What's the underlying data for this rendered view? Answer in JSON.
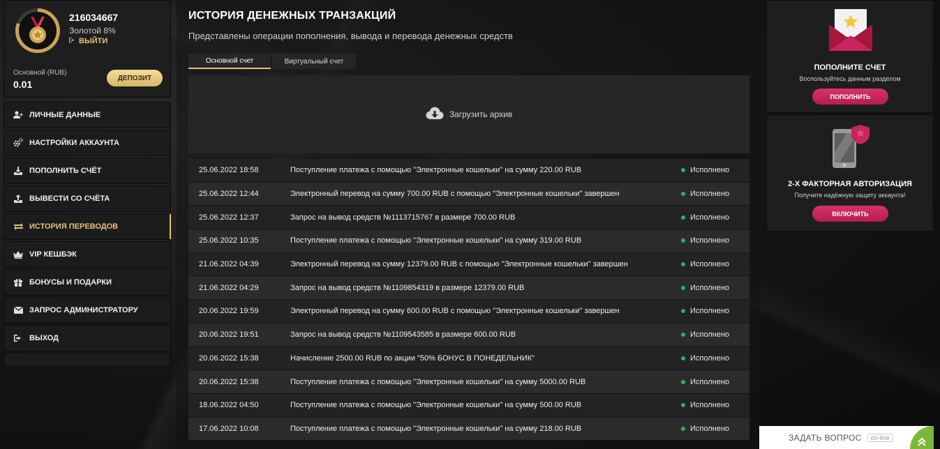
{
  "profile": {
    "user_id": "216034667",
    "level": "Золотой 8%",
    "logout_label": "ВЫЙТИ",
    "balance_label": "Основной (RUB)",
    "balance_value": "0.01",
    "deposit_label": "ДЕПОЗИТ"
  },
  "menu": [
    {
      "label": "ЛИЧНЫЕ ДАННЫЕ",
      "icon": "user-plus-icon"
    },
    {
      "label": "НАСТРОЙКИ АККАУНТА",
      "icon": "gears-icon"
    },
    {
      "label": "ПОПОЛНИТЬ СЧЁТ",
      "icon": "download-icon"
    },
    {
      "label": "ВЫВЕСТИ СО СЧЁТА",
      "icon": "upload-icon"
    },
    {
      "label": "ИСТОРИЯ ПЕРЕВОДОВ",
      "icon": "transfer-arrows-icon",
      "active": true
    },
    {
      "label": "VIP КЕШБЭК",
      "icon": "crown-icon"
    },
    {
      "label": "БОНУСЫ И ПОДАРКИ",
      "icon": "gift-icon"
    },
    {
      "label": "ЗАПРОС АДМИНИСТРАТОРУ",
      "icon": "envelope-icon"
    },
    {
      "label": "ВЫХОД",
      "icon": "sign-out-icon"
    }
  ],
  "main": {
    "title": "ИСТОРИЯ ДЕНЕЖНЫХ ТРАНЗАКЦИЙ",
    "subtitle": "Представлены операции пополнения, вывода и перевода денежных средств",
    "tabs": [
      "Основной счет",
      "Виртуальный счет"
    ],
    "archive_label": "Загрузить архив"
  },
  "transactions": [
    {
      "date": "25.06.2022 18:58",
      "desc": "Поступление платежа с помощью \"Электронные кошельки\" на сумму 220.00 RUB",
      "status": "Исполнено"
    },
    {
      "date": "25.06.2022 12:44",
      "desc": "Электронный перевод на сумму 700.00 RUB с помощью \"Электронные кошельки\" завершен",
      "status": "Исполнено"
    },
    {
      "date": "25.06.2022 12:37",
      "desc": "Запрос на вывод средств №1113715767 в размере 700.00 RUB",
      "status": "Исполнено"
    },
    {
      "date": "25.06.2022 10:35",
      "desc": "Поступление платежа с помощью \"Электронные кошельки\" на сумму 319.00 RUB",
      "status": "Исполнено"
    },
    {
      "date": "21.06.2022 04:39",
      "desc": "Электронный перевод на сумму 12379.00 RUB с помощью \"Электронные кошельки\" завершен",
      "status": "Исполнено"
    },
    {
      "date": "21.06.2022 04:29",
      "desc": "Запрос на вывод средств №1109854319 в размере 12379.00 RUB",
      "status": "Исполнено"
    },
    {
      "date": "20.06.2022 19:59",
      "desc": "Электронный перевод на сумму 600.00 RUB с помощью \"Электронные кошельки\" завершен",
      "status": "Исполнено"
    },
    {
      "date": "20.06.2022 19:51",
      "desc": "Запрос на вывод средств №1109543585 в размере 600.00 RUB",
      "status": "Исполнено"
    },
    {
      "date": "20.06.2022 15:38",
      "desc": "Начисление 2500.00 RUB по акции \"50% БОНУС В ПОНЕДЕЛЬНИК\"",
      "status": "Исполнено"
    },
    {
      "date": "20.06.2022 15:38",
      "desc": "Поступление платежа с помощью \"Электронные кошельки\" на сумму 5000.00 RUB",
      "status": "Исполнено"
    },
    {
      "date": "18.06.2022 04:50",
      "desc": "Поступление платежа с помощью \"Электронные кошельки\" на сумму 500.00 RUB",
      "status": "Исполнено"
    },
    {
      "date": "17.06.2022 10:08",
      "desc": "Поступление платежа с помощью \"Электронные кошельки\" на сумму 218.00 RUB",
      "status": "Исполнено"
    }
  ],
  "right": {
    "card1": {
      "title": "ПОПОЛНИТЕ СЧЕТ",
      "text": "Воспользуйтесь данным разделом",
      "button": "ПОПОЛНИТЬ"
    },
    "card2": {
      "title": "2-Х ФАКТОРНАЯ АВТОРИЗАЦИЯ",
      "text": "Получите надёжную защиту аккаунта!",
      "button": "ВКЛЮЧИТЬ"
    }
  },
  "chat": {
    "label": "ЗАДАТЬ ВОПРОС",
    "badge": "on-line"
  },
  "colors": {
    "accent_gold": "#e3c27a",
    "pink": "#c8245d",
    "status_green": "#2db35d"
  }
}
